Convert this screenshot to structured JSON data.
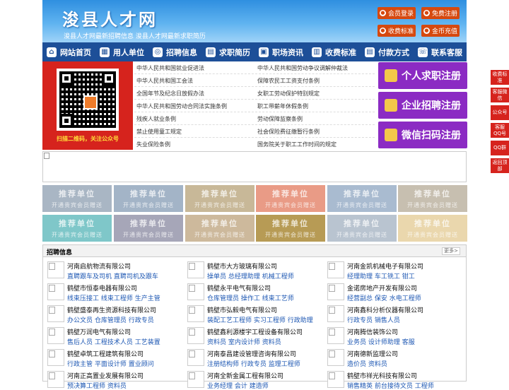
{
  "header": {
    "site_name": "浚县人才网",
    "slogan": "浚县人才网最新招聘信息   浚县人才网最新求职简历",
    "buttons": [
      {
        "label": "会员登录",
        "icon": "user-icon"
      },
      {
        "label": "免费注册",
        "icon": "register-icon"
      },
      {
        "label": "收费标准",
        "icon": "price-icon"
      },
      {
        "label": "金币充值",
        "icon": "coin-icon"
      }
    ]
  },
  "nav": [
    {
      "label": "网站首页",
      "icon": "home-icon"
    },
    {
      "label": "用人单位",
      "icon": "building-icon"
    },
    {
      "label": "招聘信息",
      "icon": "recruit-icon"
    },
    {
      "label": "求职简历",
      "icon": "resume-icon"
    },
    {
      "label": "职场资讯",
      "icon": "news-icon"
    },
    {
      "label": "收费标准",
      "icon": "price-icon"
    },
    {
      "label": "付款方式",
      "icon": "payment-icon"
    },
    {
      "label": "联系客服",
      "icon": "phone-icon"
    }
  ],
  "qr": {
    "caption": "扫描二维码，关注公众号"
  },
  "laws": [
    "中华人民共和国就业促进法",
    "中华人民共和国劳动争议调解仲裁法",
    "中华人民共和国工会法",
    "保障农民工工资支付条例",
    "全国年节及纪念日放假办法",
    "女职工劳动保护特别规定",
    "中华人民共和国劳动合同法实施条例",
    "职工带薪年休假条例",
    "残疾人就业条例",
    "劳动保障监察条例",
    "禁止使用童工规定",
    "社会保险费征缴暂行条例",
    "失业保险条例",
    "国务院关于职工工作时间的规定"
  ],
  "register": [
    "个人求职注册",
    "企业招聘注册",
    "微信扫码注册"
  ],
  "recommend": {
    "title": "推荐单位",
    "subtitle": "开通贵宾会员赠送",
    "colors": [
      "#a9b6c4",
      "#a3b4c7",
      "#c8b898",
      "#e99b86",
      "#a9bbd0",
      "#c7bfb0",
      "#7fc7c9",
      "#a6a6b8",
      "#cdb99c",
      "#b79b55",
      "#b9c4d0",
      "#ead7ad"
    ]
  },
  "jobs": {
    "title": "招聘信息",
    "more": "更多>",
    "companies": [
      {
        "name": "河南启航物流有限公司",
        "positions": "直聘跟车及司机 直聘司机及跟车"
      },
      {
        "name": "鹤壁市大方玻璃有限公司",
        "positions": "操单员 总经理助理 机械工程师"
      },
      {
        "name": "河南金凯机械电子有限公司",
        "positions": "经理助理 车工铣工 钳工"
      },
      {
        "name": "鹤壁市恒泰电器有限公司",
        "positions": "线束压接工 线束工程师 生产主管"
      },
      {
        "name": "鹤壁永平电气有限公司",
        "positions": "仓库管理员 操作工 线束工艺师"
      },
      {
        "name": "金诺房地产开发有限公司",
        "positions": "经营副总 保安 水电工程师"
      },
      {
        "name": "鹤壁盛泰再生资源科技有限公司",
        "positions": "办公文员 仓库管理员 行政专员"
      },
      {
        "name": "鹤壁市弘毅电气有限公司",
        "positions": "装配工艺工程师 实习工程师 行政助理"
      },
      {
        "name": "河南鑫科分析仪器有限公司",
        "positions": "行政专员 销售人员"
      },
      {
        "name": "鹤壁万润电气有限公司",
        "positions": "售后人员 工程技术人员 工艺装置"
      },
      {
        "name": "鹤壁鑫利源楼宇工程设备有限公司",
        "positions": "资料员 室内设计师 资料员"
      },
      {
        "name": "河南腾信装饰公司",
        "positions": "业务员 设计师助理 客服"
      },
      {
        "name": "鹤壁卓筑工程建筑有限公司",
        "positions": "行政主管 平面设计师 置业顾问"
      },
      {
        "name": "河南泰昌建设管理咨询有限公司",
        "positions": "注册结构师 行政专员 监理工程师"
      },
      {
        "name": "河南德新监理公司",
        "positions": "造价员 资料员"
      },
      {
        "name": "河南正高置业发展有限公司",
        "positions": "预决算工程师 资料员"
      },
      {
        "name": "河南全新金属工程有限公司",
        "positions": "业务经理 会计 建造师"
      },
      {
        "name": "鹤壁市祥光科技有限公司",
        "positions": "销售精英 前台接待文员 工程师"
      }
    ]
  },
  "side": [
    "收费标准",
    "客服微信",
    "公众号",
    "客服QQ号",
    "QQ群",
    "返回顶部"
  ]
}
